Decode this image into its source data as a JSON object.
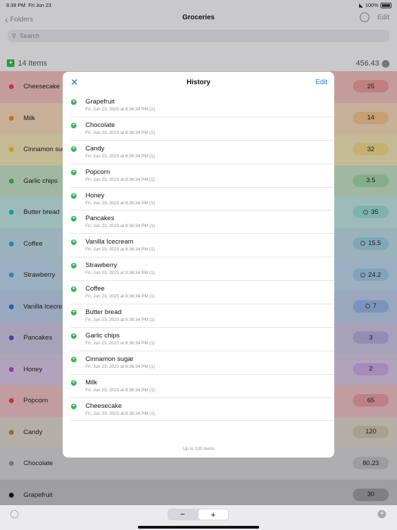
{
  "status_bar": {
    "time": "8:39 PM",
    "date": "Fri Jun 23",
    "battery": "100%"
  },
  "nav": {
    "back_label": "Folders",
    "title": "Groceries",
    "edit_label": "Edit"
  },
  "search": {
    "placeholder": "Search"
  },
  "summary": {
    "count_label": "14 Items",
    "total": "456.43"
  },
  "items": [
    {
      "name": "Cheesecake",
      "value": "25",
      "dot": "#e24848",
      "row_bg": "#ecbcbc",
      "pill_bg": "#e89b9b",
      "clock": false
    },
    {
      "name": "Milk",
      "value": "14",
      "dot": "#f08a1c",
      "row_bg": "#f0d4b6",
      "pill_bg": "#f0c08c",
      "clock": false
    },
    {
      "name": "Cinnamon sugar",
      "value": "32",
      "dot": "#e8c21f",
      "row_bg": "#ece0b4",
      "pill_bg": "#ecd68a",
      "clock": false
    },
    {
      "name": "Garlic chips",
      "value": "3.5",
      "dot": "#37b857",
      "row_bg": "#c1ddc3",
      "pill_bg": "#a0d0a8",
      "clock": false
    },
    {
      "name": "Butter bread",
      "value": "35",
      "dot": "#1cc0b0",
      "row_bg": "#bde2df",
      "pill_bg": "#9ad6cf",
      "clock": true
    },
    {
      "name": "Coffee",
      "value": "15.5",
      "dot": "#2ba3d1",
      "row_bg": "#bad6e2",
      "pill_bg": "#9cc8dc",
      "clock": true
    },
    {
      "name": "Strawberry",
      "value": "24.2",
      "dot": "#3a9ee0",
      "row_bg": "#bad3e6",
      "pill_bg": "#9ec4e2",
      "clock": true
    },
    {
      "name": "Vanilla Icecream",
      "value": "7",
      "dot": "#2a73e0",
      "row_bg": "#b8c9e6",
      "pill_bg": "#96b2e2",
      "clock": true
    },
    {
      "name": "Pancakes",
      "value": "3",
      "dot": "#5a4bc8",
      "row_bg": "#c8c3e0",
      "pill_bg": "#b3aad8",
      "clock": false
    },
    {
      "name": "Honey",
      "value": "2",
      "dot": "#9a4bcf",
      "row_bg": "#d6c4e4",
      "pill_bg": "#c8a8e0",
      "clock": false
    },
    {
      "name": "Popcorn",
      "value": "65",
      "dot": "#e0404f",
      "row_bg": "#e8bcc1",
      "pill_bg": "#e39aa3",
      "clock": false
    },
    {
      "name": "Candy",
      "value": "120",
      "dot": "#9a8456",
      "row_bg": "#d9d3c9",
      "pill_bg": "#cbc2b0",
      "clock": false
    },
    {
      "name": "Chocolate",
      "value": "80.23",
      "dot": "#8e8e93",
      "row_bg": "#d2d2d4",
      "pill_bg": "#bdbdc1",
      "clock": false
    },
    {
      "name": "Grapefruit",
      "value": "30",
      "dot": "#111111",
      "row_bg": "#c0c0c2",
      "pill_bg": "#9a9a9e",
      "clock": false
    }
  ],
  "bottom": {
    "minus": "−",
    "plus": "+"
  },
  "modal": {
    "title": "History",
    "edit_label": "Edit",
    "footer": "Up to 100 items",
    "entries": [
      {
        "name": "Grapefruit",
        "detail": "Fri, Jun 23, 2023 at 8:36:34 PM   (1)"
      },
      {
        "name": "Chocolate",
        "detail": "Fri, Jun 23, 2023 at 8:36:34 PM   (1)"
      },
      {
        "name": "Candy",
        "detail": "Fri, Jun 23, 2023 at 8:36:34 PM   (1)"
      },
      {
        "name": "Popcorn",
        "detail": "Fri, Jun 23, 2023 at 8:36:34 PM   (1)"
      },
      {
        "name": "Honey",
        "detail": "Fri, Jun 23, 2023 at 8:36:34 PM   (1)"
      },
      {
        "name": "Pancakes",
        "detail": "Fri, Jun 23, 2023 at 8:36:34 PM   (1)"
      },
      {
        "name": "Vanilla Icecream",
        "detail": "Fri, Jun 23, 2023 at 8:36:34 PM   (1)"
      },
      {
        "name": "Strawberry",
        "detail": "Fri, Jun 23, 2023 at 8:36:34 PM   (1)"
      },
      {
        "name": "Coffee",
        "detail": "Fri, Jun 23, 2023 at 8:36:34 PM   (1)"
      },
      {
        "name": "Butter bread",
        "detail": "Fri, Jun 23, 2023 at 8:36:34 PM   (1)"
      },
      {
        "name": "Garlic chips",
        "detail": "Fri, Jun 23, 2023 at 8:36:34 PM   (1)"
      },
      {
        "name": "Cinnamon sugar",
        "detail": "Fri, Jun 23, 2023 at 8:36:34 PM   (1)"
      },
      {
        "name": "Milk",
        "detail": "Fri, Jun 23, 2023 at 8:36:34 PM   (1)"
      },
      {
        "name": "Cheesecake",
        "detail": "Fri, Jun 23, 2023 at 8:36:34 PM   (1)"
      }
    ]
  }
}
